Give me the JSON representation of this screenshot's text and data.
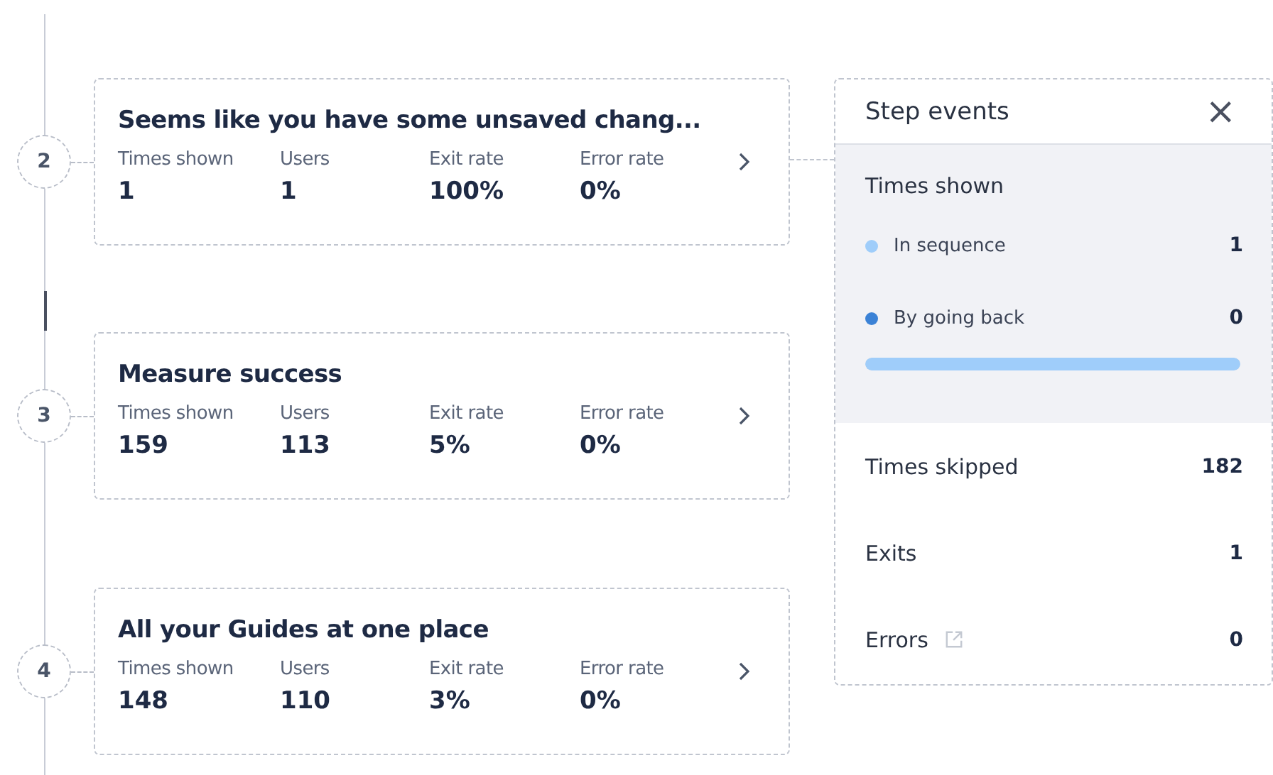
{
  "steps": [
    {
      "number": "2",
      "title": "Seems like you have some unsaved chang...",
      "connected": true,
      "metrics": [
        {
          "label": "Times shown",
          "value": "1"
        },
        {
          "label": "Users",
          "value": "1"
        },
        {
          "label": "Exit rate",
          "value": "100%"
        },
        {
          "label": "Error rate",
          "value": "0%"
        }
      ]
    },
    {
      "number": "3",
      "title": "Measure success",
      "connected": false,
      "metrics": [
        {
          "label": "Times shown",
          "value": "159"
        },
        {
          "label": "Users",
          "value": "113"
        },
        {
          "label": "Exit rate",
          "value": "5%"
        },
        {
          "label": "Error rate",
          "value": "0%"
        }
      ]
    },
    {
      "number": "4",
      "title": "All your Guides at one place",
      "connected": false,
      "metrics": [
        {
          "label": "Times shown",
          "value": "148"
        },
        {
          "label": "Users",
          "value": "110"
        },
        {
          "label": "Exit rate",
          "value": "3%"
        },
        {
          "label": "Error rate",
          "value": "0%"
        }
      ]
    }
  ],
  "panel": {
    "title": "Step events",
    "close": "×",
    "times_shown": {
      "label": "Times shown",
      "level": 1,
      "breakdown": [
        {
          "label": "In sequence",
          "value": "1",
          "color": "#9fcdfa"
        },
        {
          "label": "By going back",
          "value": "0",
          "color": "#3b82d6"
        }
      ]
    },
    "rows": [
      {
        "label": "Times skipped",
        "value": "182",
        "kind": "plain"
      },
      {
        "label": "Exits",
        "value": "1",
        "kind": "plain"
      },
      {
        "label": "Errors",
        "value": "0",
        "kind": "link"
      }
    ]
  }
}
